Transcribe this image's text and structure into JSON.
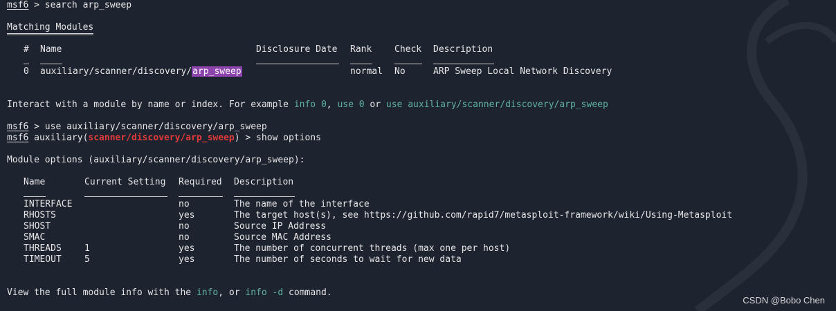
{
  "prompt": {
    "name": "msf6"
  },
  "lines": {
    "search_cmd": " > search arp_sweep",
    "matching_title": "Matching Modules",
    "interact_pre": "Interact with a module by name or index. For example ",
    "interact_c1": "info 0",
    "interact_sep1": ", ",
    "interact_c2": "use 0",
    "interact_sep2": " or ",
    "interact_c3": "use auxiliary/scanner/discovery/arp_sweep",
    "use_cmd": " > use auxiliary/scanner/discovery/arp_sweep",
    "aux_pre": " auxiliary(",
    "aux_mod": "scanner/discovery/arp_sweep",
    "aux_post": ") > show options",
    "module_options": "Module options (auxiliary/scanner/discovery/arp_sweep):",
    "view_pre": "View the full module info with the ",
    "view_c1": "info",
    "view_mid": ", or ",
    "view_c2": "info -d",
    "view_post": " command."
  },
  "search_table": {
    "headers": {
      "num": "#",
      "name": "Name",
      "date": "Disclosure Date",
      "rank": "Rank",
      "check": "Check",
      "desc": "Description"
    },
    "row": {
      "num": "0",
      "name_prefix": "auxiliary/scanner/discovery/",
      "name_highlight": "arp_sweep",
      "date": "",
      "rank": "normal",
      "check": "No",
      "desc": "ARP Sweep Local Network Discovery"
    }
  },
  "options_table": {
    "headers": {
      "name": "Name",
      "setting": "Current Setting",
      "required": "Required",
      "desc": "Description"
    },
    "rows": [
      {
        "name": "INTERFACE",
        "setting": "",
        "required": "no",
        "desc": "The name of the interface"
      },
      {
        "name": "RHOSTS",
        "setting": "",
        "required": "yes",
        "desc": "The target host(s), see https://github.com/rapid7/metasploit-framework/wiki/Using-Metasploit"
      },
      {
        "name": "SHOST",
        "setting": "",
        "required": "no",
        "desc": "Source IP Address"
      },
      {
        "name": "SMAC",
        "setting": "",
        "required": "no",
        "desc": "Source MAC Address"
      },
      {
        "name": "THREADS",
        "setting": "1",
        "required": "yes",
        "desc": "The number of concurrent threads (max one per host)"
      },
      {
        "name": "TIMEOUT",
        "setting": "5",
        "required": "yes",
        "desc": "The number of seconds to wait for new data"
      }
    ]
  },
  "watermark": {
    "text": "CSDN @Bobo Chen"
  },
  "colors": {
    "background": "#1e2330",
    "command": "#5fb3a1",
    "module_red": "#e03a3a",
    "highlight": "#8e44ad"
  }
}
